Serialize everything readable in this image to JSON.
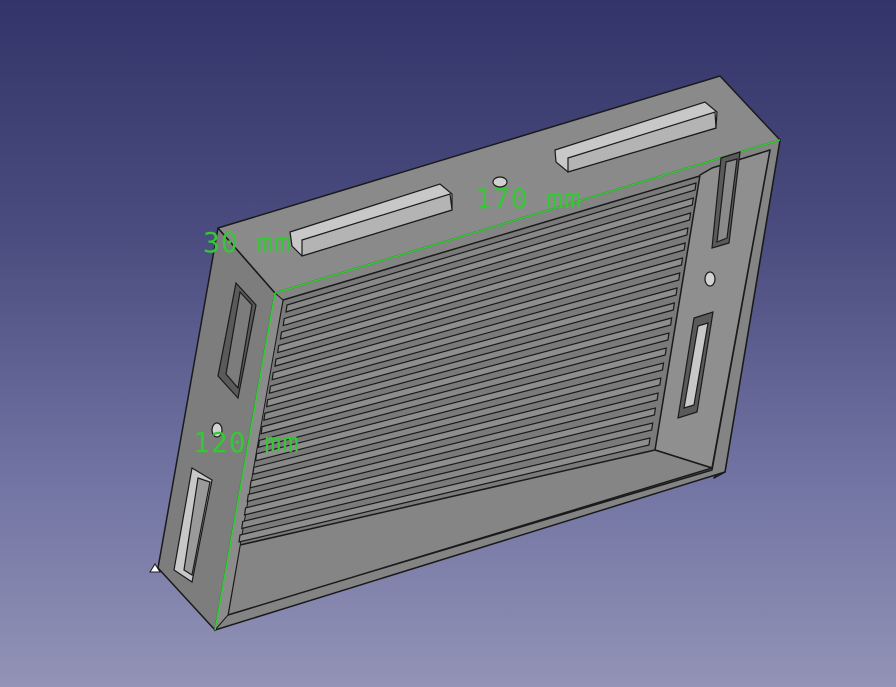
{
  "view": {
    "background_top": "#33356a",
    "background_bottom": "#9293b6"
  },
  "model": {
    "fill_color": "#808080",
    "edge_color": "#1a1a1a",
    "highlight_color": "#2fd02f"
  },
  "dimensions": {
    "depth_label": "30 mm",
    "length_label": "170 mm",
    "width_label": "120 mm",
    "color": "#35c735"
  }
}
